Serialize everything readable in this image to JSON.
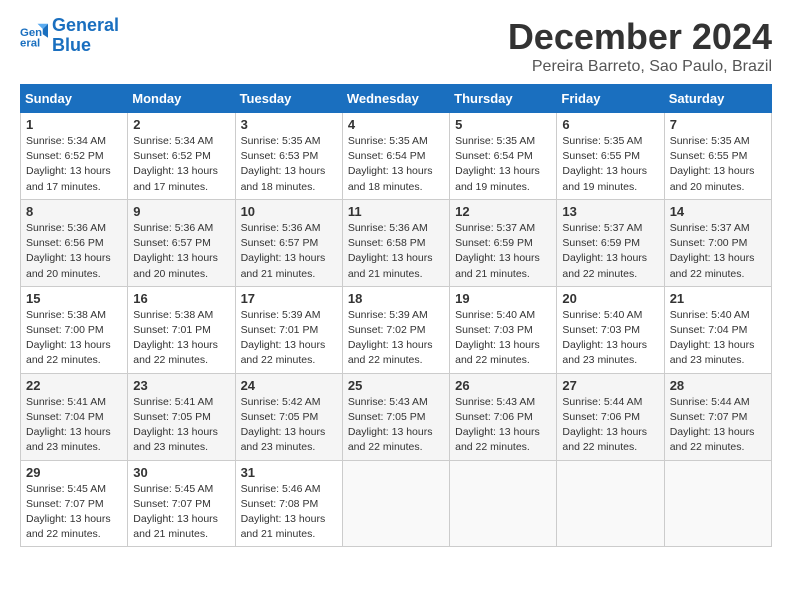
{
  "logo": {
    "line1": "General",
    "line2": "Blue"
  },
  "title": "December 2024",
  "subtitle": "Pereira Barreto, Sao Paulo, Brazil",
  "days_header": [
    "Sunday",
    "Monday",
    "Tuesday",
    "Wednesday",
    "Thursday",
    "Friday",
    "Saturday"
  ],
  "weeks": [
    [
      {
        "day": "1",
        "sunrise": "5:34 AM",
        "sunset": "6:52 PM",
        "daylight": "13 hours and 17 minutes."
      },
      {
        "day": "2",
        "sunrise": "5:34 AM",
        "sunset": "6:52 PM",
        "daylight": "13 hours and 17 minutes."
      },
      {
        "day": "3",
        "sunrise": "5:35 AM",
        "sunset": "6:53 PM",
        "daylight": "13 hours and 18 minutes."
      },
      {
        "day": "4",
        "sunrise": "5:35 AM",
        "sunset": "6:54 PM",
        "daylight": "13 hours and 18 minutes."
      },
      {
        "day": "5",
        "sunrise": "5:35 AM",
        "sunset": "6:54 PM",
        "daylight": "13 hours and 19 minutes."
      },
      {
        "day": "6",
        "sunrise": "5:35 AM",
        "sunset": "6:55 PM",
        "daylight": "13 hours and 19 minutes."
      },
      {
        "day": "7",
        "sunrise": "5:35 AM",
        "sunset": "6:55 PM",
        "daylight": "13 hours and 20 minutes."
      }
    ],
    [
      {
        "day": "8",
        "sunrise": "5:36 AM",
        "sunset": "6:56 PM",
        "daylight": "13 hours and 20 minutes."
      },
      {
        "day": "9",
        "sunrise": "5:36 AM",
        "sunset": "6:57 PM",
        "daylight": "13 hours and 20 minutes."
      },
      {
        "day": "10",
        "sunrise": "5:36 AM",
        "sunset": "6:57 PM",
        "daylight": "13 hours and 21 minutes."
      },
      {
        "day": "11",
        "sunrise": "5:36 AM",
        "sunset": "6:58 PM",
        "daylight": "13 hours and 21 minutes."
      },
      {
        "day": "12",
        "sunrise": "5:37 AM",
        "sunset": "6:59 PM",
        "daylight": "13 hours and 21 minutes."
      },
      {
        "day": "13",
        "sunrise": "5:37 AM",
        "sunset": "6:59 PM",
        "daylight": "13 hours and 22 minutes."
      },
      {
        "day": "14",
        "sunrise": "5:37 AM",
        "sunset": "7:00 PM",
        "daylight": "13 hours and 22 minutes."
      }
    ],
    [
      {
        "day": "15",
        "sunrise": "5:38 AM",
        "sunset": "7:00 PM",
        "daylight": "13 hours and 22 minutes."
      },
      {
        "day": "16",
        "sunrise": "5:38 AM",
        "sunset": "7:01 PM",
        "daylight": "13 hours and 22 minutes."
      },
      {
        "day": "17",
        "sunrise": "5:39 AM",
        "sunset": "7:01 PM",
        "daylight": "13 hours and 22 minutes."
      },
      {
        "day": "18",
        "sunrise": "5:39 AM",
        "sunset": "7:02 PM",
        "daylight": "13 hours and 22 minutes."
      },
      {
        "day": "19",
        "sunrise": "5:40 AM",
        "sunset": "7:03 PM",
        "daylight": "13 hours and 22 minutes."
      },
      {
        "day": "20",
        "sunrise": "5:40 AM",
        "sunset": "7:03 PM",
        "daylight": "13 hours and 23 minutes."
      },
      {
        "day": "21",
        "sunrise": "5:40 AM",
        "sunset": "7:04 PM",
        "daylight": "13 hours and 23 minutes."
      }
    ],
    [
      {
        "day": "22",
        "sunrise": "5:41 AM",
        "sunset": "7:04 PM",
        "daylight": "13 hours and 23 minutes."
      },
      {
        "day": "23",
        "sunrise": "5:41 AM",
        "sunset": "7:05 PM",
        "daylight": "13 hours and 23 minutes."
      },
      {
        "day": "24",
        "sunrise": "5:42 AM",
        "sunset": "7:05 PM",
        "daylight": "13 hours and 23 minutes."
      },
      {
        "day": "25",
        "sunrise": "5:43 AM",
        "sunset": "7:05 PM",
        "daylight": "13 hours and 22 minutes."
      },
      {
        "day": "26",
        "sunrise": "5:43 AM",
        "sunset": "7:06 PM",
        "daylight": "13 hours and 22 minutes."
      },
      {
        "day": "27",
        "sunrise": "5:44 AM",
        "sunset": "7:06 PM",
        "daylight": "13 hours and 22 minutes."
      },
      {
        "day": "28",
        "sunrise": "5:44 AM",
        "sunset": "7:07 PM",
        "daylight": "13 hours and 22 minutes."
      }
    ],
    [
      {
        "day": "29",
        "sunrise": "5:45 AM",
        "sunset": "7:07 PM",
        "daylight": "13 hours and 22 minutes."
      },
      {
        "day": "30",
        "sunrise": "5:45 AM",
        "sunset": "7:07 PM",
        "daylight": "13 hours and 21 minutes."
      },
      {
        "day": "31",
        "sunrise": "5:46 AM",
        "sunset": "7:08 PM",
        "daylight": "13 hours and 21 minutes."
      },
      null,
      null,
      null,
      null
    ]
  ]
}
